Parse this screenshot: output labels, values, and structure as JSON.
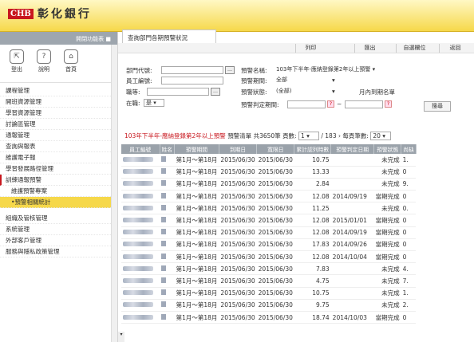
{
  "brand": {
    "logo_box": "CHB",
    "logo_text": "彰化銀行"
  },
  "page_tab": "查詢部門各期預警狀況",
  "sidebar": {
    "collapse_label": "開閉功能表 ■",
    "icons": [
      {
        "label": "登出",
        "icon": "logout-icon",
        "glyph": "⇱"
      },
      {
        "label": "說明",
        "icon": "help-icon",
        "glyph": "?"
      },
      {
        "label": "首頁",
        "icon": "home-icon",
        "glyph": "⌂"
      }
    ],
    "menu": [
      "課程管理",
      "開班資源管理",
      "學習資源管理",
      "討論區管理",
      "通報管理",
      "查詢與報表",
      "維護電子報",
      "學習發展路徑管理"
    ],
    "active_item": "訓練通報預警",
    "sub_items": [
      "維護預警專案",
      "•預警相關統計"
    ],
    "menu2": [
      "組織及管核管理",
      "系統管理",
      "外部客戶管理",
      "服務與隱私政策管理"
    ]
  },
  "toolbar": {
    "print": "列印",
    "export": "匯出",
    "custom_fields": "自選欄位",
    "back": "返回"
  },
  "form": {
    "dept_code_label": "部門代號:",
    "emp_id_label": "員工編號:",
    "title_label": "職等:",
    "in_service_label": "在職:",
    "in_service_value": "是",
    "alert_name_label": "預警名稱:",
    "alert_name_value": "103年下半年-應納登錄第2年以上預警",
    "alert_period_label": "預警期間:",
    "alert_period_value": "全部",
    "alert_status_label": "預警狀態:",
    "alert_status_value": "(全部)",
    "month_due_label": "月內到期名單",
    "alert_judge_label": "預警判定期間:",
    "range_sep": "~",
    "search_btn": "搜尋"
  },
  "summary": {
    "name": "103年下半年-應納登錄第2年以上預警",
    "list_label": "預警清單",
    "total": "共3650筆",
    "page_label": "頁數:",
    "page_value": "1",
    "page_total": "/ 183",
    "per_page_label": "每頁筆數:",
    "per_page_value": "20"
  },
  "table": {
    "columns": [
      "員工編號",
      "姓名",
      "預警期間",
      "到期日",
      "寬限日",
      "累計認列時數",
      "預警判定日期",
      "預警狀態",
      "尚缺"
    ],
    "rows": [
      [
        "",
        "",
        "第1月～第18月",
        "2015/06/30",
        "2015/06/30",
        "10.75",
        "",
        "未完成",
        "1."
      ],
      [
        "",
        "",
        "第1月～第18月",
        "2015/06/30",
        "2015/06/30",
        "13.33",
        "",
        "未完成",
        "0"
      ],
      [
        "",
        "",
        "第1月～第18月",
        "2015/06/30",
        "2015/06/30",
        "2.84",
        "",
        "未完成",
        "9."
      ],
      [
        "",
        "",
        "第1月～第18月",
        "2015/06/30",
        "2015/06/30",
        "12.08",
        "2014/09/19",
        "當期完成",
        "0"
      ],
      [
        "",
        "",
        "第1月～第18月",
        "2015/06/30",
        "2015/06/30",
        "11.25",
        "",
        "未完成",
        "0."
      ],
      [
        "",
        "",
        "第1月～第18月",
        "2015/06/30",
        "2015/06/30",
        "12.08",
        "2015/01/01",
        "當期完成",
        "0"
      ],
      [
        "",
        "",
        "第1月～第18月",
        "2015/06/30",
        "2015/06/30",
        "12.08",
        "2014/09/19",
        "當期完成",
        "0"
      ],
      [
        "",
        "",
        "第1月～第18月",
        "2015/06/30",
        "2015/06/30",
        "17.83",
        "2014/09/26",
        "當期完成",
        "0"
      ],
      [
        "",
        "",
        "第1月～第18月",
        "2015/06/30",
        "2015/06/30",
        "12.08",
        "2014/10/04",
        "當期完成",
        "0"
      ],
      [
        "",
        "",
        "第1月～第18月",
        "2015/06/30",
        "2015/06/30",
        "7.83",
        "",
        "未完成",
        "4."
      ],
      [
        "",
        "",
        "第1月～第18月",
        "2015/06/30",
        "2015/06/30",
        "4.75",
        "",
        "未完成",
        "7."
      ],
      [
        "",
        "",
        "第1月～第18月",
        "2015/06/30",
        "2015/06/30",
        "10.75",
        "",
        "未完成",
        "1."
      ],
      [
        "",
        "",
        "第1月～第18月",
        "2015/06/30",
        "2015/06/30",
        "9.75",
        "",
        "未完成",
        "2."
      ],
      [
        "",
        "",
        "第1月～第18月",
        "2015/06/30",
        "2015/06/30",
        "18.74",
        "2014/10/03",
        "當期完成",
        "0"
      ]
    ]
  }
}
